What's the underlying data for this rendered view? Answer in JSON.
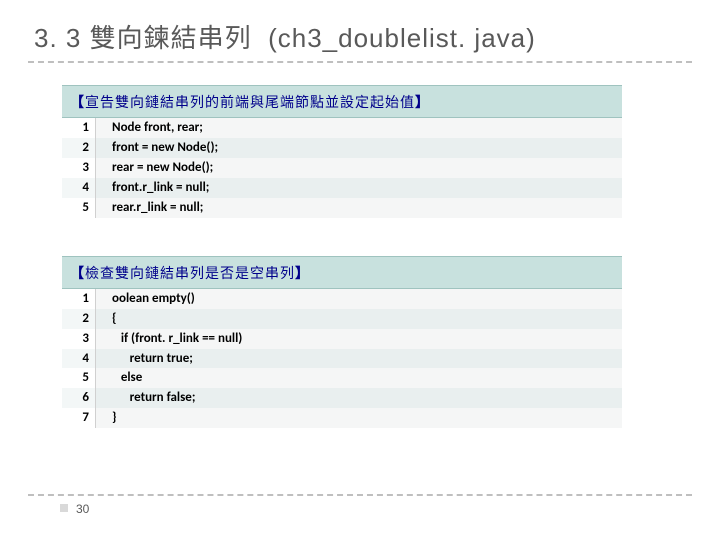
{
  "title": {
    "section_num": "3. 3",
    "section_title_zh": "雙向鍊結串列",
    "section_title_paren": "(ch3_doublelist. java)"
  },
  "block1": {
    "header_open": "【",
    "header_text": "宣告雙向鏈結串列的前端與尾端節點並設定起始值",
    "header_close": "】",
    "lines": [
      {
        "n": "1",
        "c": "Node front, rear;"
      },
      {
        "n": "2",
        "c": "front = new Node();"
      },
      {
        "n": "3",
        "c": "rear = new Node();"
      },
      {
        "n": "4",
        "c": "front.r_link = null;"
      },
      {
        "n": "5",
        "c": "rear.r_link = null;"
      }
    ]
  },
  "block2": {
    "header_open": "【",
    "header_text": "檢查雙向鏈結串列是否是空串列",
    "header_close": "】",
    "lines": [
      {
        "n": "1",
        "c": "oolean empty()"
      },
      {
        "n": "2",
        "c": "{"
      },
      {
        "n": "3",
        "c": "   if (front. r_link == null)"
      },
      {
        "n": "4",
        "c": "      return true;"
      },
      {
        "n": "5",
        "c": "   else"
      },
      {
        "n": "6",
        "c": "      return false;"
      },
      {
        "n": "7",
        "c": "}"
      }
    ]
  },
  "page_number": "30"
}
